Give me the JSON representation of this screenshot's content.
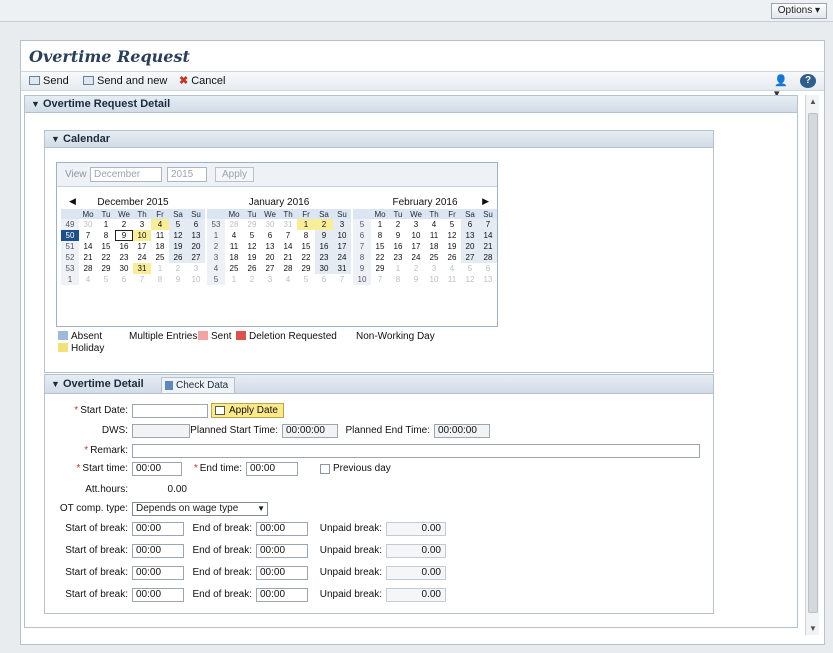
{
  "top": {
    "options_label": "Options ▾"
  },
  "app": {
    "title": "Overtime Request"
  },
  "toolbar": {
    "send": "Send",
    "send_new": "Send and new",
    "cancel": "Cancel",
    "user_icon": "user-icon",
    "help_icon": "help-icon"
  },
  "trays": {
    "detail": "Overtime Request Detail",
    "calendar": "Calendar"
  },
  "view": {
    "label": "View",
    "month": "December",
    "year": "2015",
    "apply": "Apply"
  },
  "weekday_headers": [
    "Mo",
    "Tu",
    "We",
    "Th",
    "Fr",
    "Sa",
    "Su"
  ],
  "months": [
    {
      "title": "December 2015",
      "weeks": [
        {
          "wk": "49",
          "days": [
            "30",
            "1",
            "2",
            "3",
            "4",
            "5",
            "6"
          ]
        },
        {
          "wk": "50",
          "days": [
            "7",
            "8",
            "9",
            "10",
            "11",
            "12",
            "13"
          ]
        },
        {
          "wk": "51",
          "days": [
            "14",
            "15",
            "16",
            "17",
            "18",
            "19",
            "20"
          ]
        },
        {
          "wk": "52",
          "days": [
            "21",
            "22",
            "23",
            "24",
            "25",
            "26",
            "27"
          ]
        },
        {
          "wk": "53",
          "days": [
            "28",
            "29",
            "30",
            "31",
            "1",
            "2",
            "3"
          ]
        },
        {
          "wk": "1",
          "days": [
            "4",
            "5",
            "6",
            "7",
            "8",
            "9",
            "10"
          ]
        }
      ]
    },
    {
      "title": "January 2016",
      "weeks": [
        {
          "wk": "53",
          "days": [
            "28",
            "29",
            "30",
            "31",
            "1",
            "2",
            "3"
          ]
        },
        {
          "wk": "1",
          "days": [
            "4",
            "5",
            "6",
            "7",
            "8",
            "9",
            "10"
          ]
        },
        {
          "wk": "2",
          "days": [
            "11",
            "12",
            "13",
            "14",
            "15",
            "16",
            "17"
          ]
        },
        {
          "wk": "3",
          "days": [
            "18",
            "19",
            "20",
            "21",
            "22",
            "23",
            "24"
          ]
        },
        {
          "wk": "4",
          "days": [
            "25",
            "26",
            "27",
            "28",
            "29",
            "30",
            "31"
          ]
        },
        {
          "wk": "5",
          "days": [
            "1",
            "2",
            "3",
            "4",
            "5",
            "6",
            "7"
          ]
        }
      ]
    },
    {
      "title": "February 2016",
      "weeks": [
        {
          "wk": "5",
          "days": [
            "1",
            "2",
            "3",
            "4",
            "5",
            "6",
            "7"
          ]
        },
        {
          "wk": "6",
          "days": [
            "8",
            "9",
            "10",
            "11",
            "12",
            "13",
            "14"
          ]
        },
        {
          "wk": "7",
          "days": [
            "15",
            "16",
            "17",
            "18",
            "19",
            "20",
            "21"
          ]
        },
        {
          "wk": "8",
          "days": [
            "22",
            "23",
            "24",
            "25",
            "26",
            "27",
            "28"
          ]
        },
        {
          "wk": "9",
          "days": [
            "29",
            "1",
            "2",
            "3",
            "4",
            "5",
            "6"
          ]
        },
        {
          "wk": "10",
          "days": [
            "7",
            "8",
            "9",
            "10",
            "11",
            "12",
            "13"
          ]
        }
      ]
    }
  ],
  "legend": {
    "absent": "Absent",
    "multiple": "Multiple Entries",
    "sent": "Sent",
    "deletion": "Deletion Requested",
    "nonworking": "Non-Working Day",
    "holiday": "Holiday"
  },
  "colors": {
    "absent": "#9fb9d8",
    "multiple": "#ffffff",
    "sent": "#f2a3a3",
    "deletion": "#d9534f",
    "nonworking": "#ffffff",
    "holiday": "#f3e27a"
  },
  "tabs": {
    "detail": "Overtime Detail",
    "check": "Check Data"
  },
  "form": {
    "start_date_label": "Start Date:",
    "start_date_value": "",
    "apply_date": "Apply Date",
    "dws_label": "DWS:",
    "dws_value": "",
    "planned_start_label": "Planned Start Time:",
    "planned_start_value": "00:00:00",
    "planned_end_label": "Planned End Time:",
    "planned_end_value": "00:00:00",
    "remark_label": "Remark:",
    "remark_value": "",
    "start_time_label": "Start time:",
    "start_time_value": "00:00",
    "end_time_label": "End time:",
    "end_time_value": "00:00",
    "previous_day_label": "Previous day",
    "att_hours_label": "Att.hours:",
    "att_hours_value": "0.00",
    "ot_type_label": "OT comp. type:",
    "ot_type_value": "Depends on wage type",
    "breaks": [
      {
        "start_label": "Start of break:",
        "start": "00:00",
        "end_label": "End of break:",
        "end": "00:00",
        "unpaid_label": "Unpaid break:",
        "unpaid": "0.00"
      },
      {
        "start_label": "Start of break:",
        "start": "00:00",
        "end_label": "End of break:",
        "end": "00:00",
        "unpaid_label": "Unpaid break:",
        "unpaid": "0.00"
      },
      {
        "start_label": "Start of break:",
        "start": "00:00",
        "end_label": "End of break:",
        "end": "00:00",
        "unpaid_label": "Unpaid break:",
        "unpaid": "0.00"
      },
      {
        "start_label": "Start of break:",
        "start": "00:00",
        "end_label": "End of break:",
        "end": "00:00",
        "unpaid_label": "Unpaid break:",
        "unpaid": "0.00"
      }
    ]
  }
}
